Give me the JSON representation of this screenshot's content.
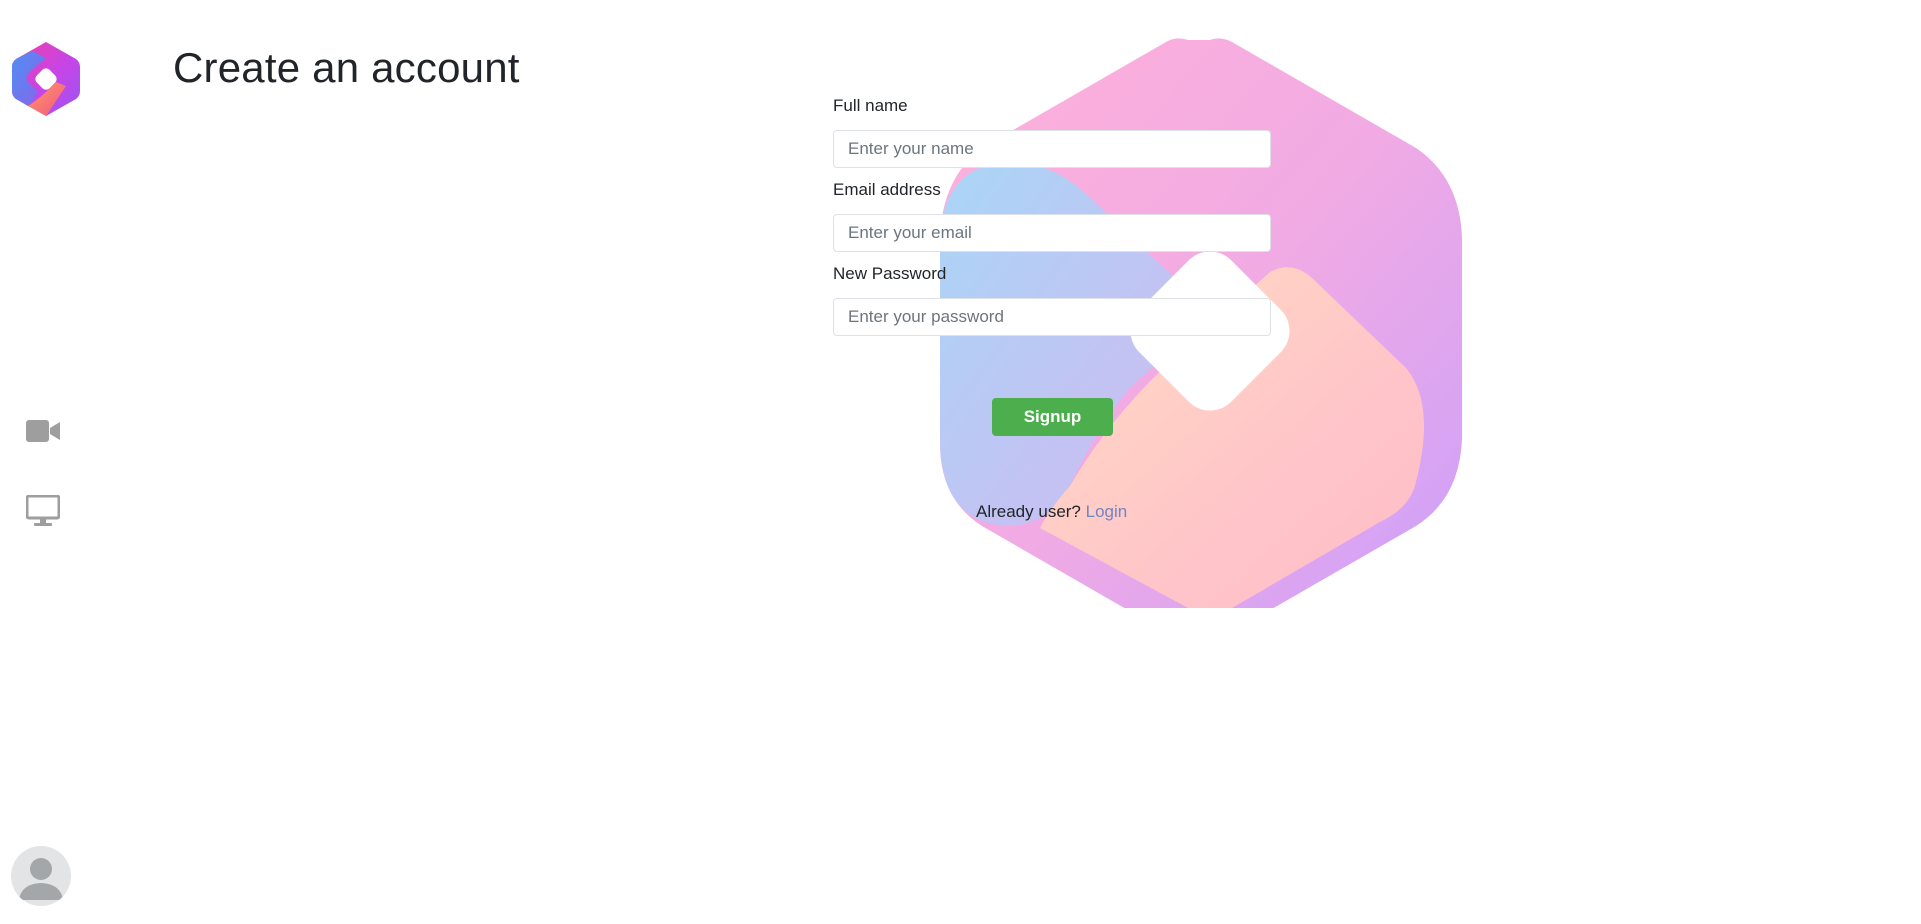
{
  "page": {
    "title": "Create an account"
  },
  "sidebar": {
    "logo_icon": "app-logo-icon",
    "items": [
      {
        "name": "video-camera-icon"
      },
      {
        "name": "monitor-icon"
      }
    ],
    "avatar_icon": "user-avatar-icon"
  },
  "form": {
    "full_name": {
      "label": "Full name",
      "placeholder": "Enter your name",
      "value": ""
    },
    "email": {
      "label": "Email address",
      "placeholder": "Enter your email",
      "value": ""
    },
    "password": {
      "label": "New Password",
      "placeholder": "Enter your password",
      "value": ""
    },
    "submit_label": "Signup",
    "login_prompt": "Already user?",
    "login_link": "Login"
  },
  "colors": {
    "primary_button": "#4cae4c",
    "link": "#6f86c7",
    "icon_gray": "#9e9e9e"
  }
}
